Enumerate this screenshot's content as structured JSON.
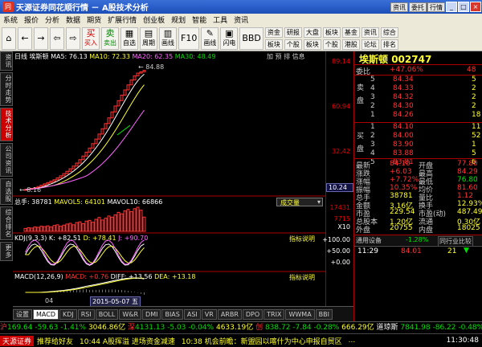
{
  "window": {
    "title": "天源证券同花顺行情 － A股技术分析",
    "buttons": [
      "资讯",
      "委托",
      "行情"
    ]
  },
  "menu": [
    "系统",
    "报价",
    "分析",
    "数据",
    "期货",
    "扩展行情",
    "创业板",
    "规划",
    "智能",
    "工具",
    "资讯"
  ],
  "toolbar": {
    "buttons": [
      {
        "icon": "⌂",
        "label": ""
      },
      {
        "icon": "←",
        "label": ""
      },
      {
        "icon": "→",
        "label": ""
      },
      {
        "icon": "⇦",
        "label": ""
      },
      {
        "icon": "⇨",
        "label": ""
      },
      {
        "icon": "买",
        "label": "买入"
      },
      {
        "icon": "卖",
        "label": "卖出"
      },
      {
        "icon": "▦",
        "label": "自选"
      },
      {
        "icon": "▤",
        "label": "周期"
      },
      {
        "icon": "▥",
        "label": "画线"
      },
      {
        "icon": "F10",
        "label": "F10"
      },
      {
        "icon": "✎",
        "label": "画线"
      },
      {
        "icon": "▣",
        "label": "闪电"
      },
      {
        "icon": "BBD",
        "label": "BBD"
      }
    ],
    "right": [
      [
        "资金",
        "板块"
      ],
      [
        "研报",
        "个股"
      ],
      [
        "大盘",
        "板块"
      ],
      [
        "板块",
        "个股"
      ],
      [
        "基金",
        "港股"
      ],
      [
        "资讯",
        "论坛"
      ],
      [
        "综合",
        "排名"
      ]
    ]
  },
  "leftnav": [
    "资讯",
    "分时走势",
    "技术分析",
    "公司资讯",
    "自选股",
    "综合排名",
    "更多"
  ],
  "chart": {
    "header": {
      "period": "日线",
      "name": "埃斯顿",
      "ma5": "MA5: 76.13",
      "ma10": "MA10: 72.33",
      "ma20": "MA20: 62.35",
      "ma30": "MA30: 48.49",
      "tools": "加 预 排 信息"
    },
    "high_label": "84.88",
    "low_label": "8.16",
    "vol": {
      "hdr_total": "总手: 38781",
      "hdr_ma5": "MAVOL5: 64101",
      "hdr_ma10": "MAVOL10: 66866",
      "selector": "成交量"
    },
    "kdj": {
      "hdr": "KDJ(9,3,3)",
      "k": "K: +82.51",
      "d": "D: +78.41",
      "j": "J: +90.70",
      "link": "指标说明"
    },
    "macd": {
      "hdr": "MACD(12,26,9)",
      "macd": "MACD: +0.76",
      "diff": "DIFF: +13.56",
      "dea": "DEA: +13.18",
      "link": "指标说明"
    },
    "date_tag": "2015-05-07 五",
    "x_label": "04"
  },
  "chart_data": {
    "type": "candlestick",
    "price_range": [
      8.16,
      84.88
    ],
    "closes": [
      8.2,
      8.5,
      8.9,
      9.4,
      10.1,
      10.9,
      11.8,
      12.6,
      13.5,
      14.4,
      15.6,
      16.9,
      18.3,
      19.8,
      21.4,
      23.1,
      25.0,
      27.2,
      29.5,
      32.0,
      34.6,
      37.4,
      40.3,
      43.5,
      46.9,
      50.2,
      53.8,
      57.6,
      61.4,
      64.8,
      68.3,
      71.6,
      74.8,
      77.9,
      80.6,
      82.3,
      83.1,
      84.1
    ],
    "volumes": [
      8,
      10,
      9,
      12,
      11,
      14,
      13,
      15,
      12,
      16,
      18,
      14,
      17,
      20,
      22,
      18,
      24,
      26,
      21,
      28,
      30,
      25,
      33,
      38,
      31,
      36,
      42,
      39,
      45,
      52,
      48,
      56,
      60,
      54,
      62,
      66,
      58,
      39
    ],
    "kdj_values": {
      "K": 82.51,
      "D": 78.41,
      "J": 90.7
    },
    "macd_values": {
      "MACD": 0.76,
      "DIFF": 13.56,
      "DEA": 13.18
    }
  },
  "axis": {
    "price": [
      "89.14",
      "60.94",
      "32.42"
    ],
    "current": "10.24",
    "vol": [
      "17431",
      "7715"
    ],
    "vol_unit": "X10",
    "kdj": [
      "+100.00",
      "+50.00",
      "+0.00"
    ],
    "macd": []
  },
  "quote": {
    "name": "埃斯顿",
    "code": "002747",
    "ratio_label": "委比",
    "ratio": "+47.06%",
    "ratio_val": "48",
    "sell_label": [
      "卖",
      "盘"
    ],
    "sells": [
      {
        "n": "5",
        "p": "84.34",
        "v": "5"
      },
      {
        "n": "4",
        "p": "84.33",
        "v": "2"
      },
      {
        "n": "3",
        "p": "84.32",
        "v": "2"
      },
      {
        "n": "2",
        "p": "84.30",
        "v": "2"
      },
      {
        "n": "1",
        "p": "84.26",
        "v": "18"
      }
    ],
    "buy_label": [
      "买",
      "盘"
    ],
    "buys": [
      {
        "n": "1",
        "p": "84.10",
        "v": "11"
      },
      {
        "n": "2",
        "p": "84.00",
        "v": "52"
      },
      {
        "n": "3",
        "p": "83.90",
        "v": "1"
      },
      {
        "n": "4",
        "p": "83.88",
        "v": "5"
      },
      {
        "n": "5",
        "p": "83.81",
        "v": "6"
      }
    ],
    "stats": [
      [
        "最新",
        "84.10",
        "开盘",
        "77.80"
      ],
      [
        "涨跌",
        "+6.03",
        "最高",
        "84.29"
      ],
      [
        "涨幅",
        "+7.72%",
        "最低",
        "76.80"
      ],
      [
        "振幅",
        "10.35%",
        "均价",
        "81.60"
      ],
      [
        "总手",
        "38781",
        "量比",
        "1.12"
      ],
      [
        "金额",
        "3.16亿",
        "换手",
        "12.93%"
      ],
      [
        "市盈",
        "229.54",
        "市盈(动)",
        "487.49"
      ],
      [
        "总股本",
        "1.20亿",
        "流通",
        "0.30亿"
      ],
      [
        "外盘",
        "20755",
        "内盘",
        "18025"
      ]
    ],
    "rel_label": "通用设备",
    "rel_pct": "-1.28%",
    "rel_btn": "同行业比较",
    "trade": {
      "time": "11:29",
      "price": "84.01",
      "vol": "21",
      "flag": "▼"
    }
  },
  "tabs": [
    "设置",
    "MACD",
    "KDJ",
    "RSI",
    "BOLL",
    "W&R",
    "DMI",
    "BIAS",
    "ASI",
    "VR",
    "ARBR",
    "DPO",
    "TRIX",
    "WWMA",
    "BBI"
  ],
  "ticker1": [
    {
      "t": "沪",
      "c": "red"
    },
    {
      "t": "169.64",
      "c": "green"
    },
    {
      "t": " -59.63 -1.41% ",
      "c": "green"
    },
    {
      "t": "3046.86亿",
      "c": "yellow"
    },
    {
      "t": " 深",
      "c": "red"
    },
    {
      "t": "4131.13",
      "c": "green"
    },
    {
      "t": "  -5.03 -0.04% ",
      "c": "green"
    },
    {
      "t": "4633.19亿",
      "c": "yellow"
    },
    {
      "t": " 创 ",
      "c": "red"
    },
    {
      "t": " 838.72",
      "c": "green"
    },
    {
      "t": "  -7.84 -0.28% ",
      "c": "green"
    },
    {
      "t": "666.29亿",
      "c": "yellow"
    },
    {
      "t": " 道琼斯 ",
      "c": "white"
    },
    {
      "t": " 7841.98 -86.22 ",
      "c": "green"
    },
    {
      "t": " -0.48%",
      "c": "green"
    }
  ],
  "ticker2": {
    "logo": "天源证券",
    "items": [
      "推荐给好友",
      "10:44 A股挥溢 进场资金减速",
      "10:38 机会前瞻：新盟园以喀什为中心申报自贸区",
      "..."
    ],
    "time": "11:30:48"
  }
}
